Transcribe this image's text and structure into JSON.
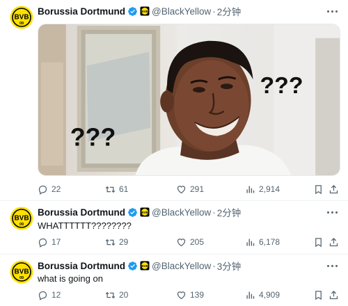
{
  "account": {
    "name": "Borussia Dortmund",
    "handle": "@BlackYellow",
    "separator": "·",
    "avatar_text": "BVB",
    "avatar_sub": "09",
    "brand_yellow": "#fde100",
    "brand_black": "#000000",
    "verified_color": "#1d9bf0"
  },
  "tweets": [
    {
      "time": "2分钟",
      "text": "",
      "media": {
        "left_marks": "???",
        "right_marks": "???"
      },
      "stats": {
        "replies": "22",
        "retweets": "61",
        "likes": "291",
        "views": "2,914"
      }
    },
    {
      "time": "2分钟",
      "text": "WHATTTTTT????????",
      "stats": {
        "replies": "17",
        "retweets": "29",
        "likes": "205",
        "views": "6,178"
      }
    },
    {
      "time": "3分钟",
      "text": "what is going on",
      "stats": {
        "replies": "12",
        "retweets": "20",
        "likes": "139",
        "views": "4,909"
      }
    }
  ],
  "icons": {
    "reply": "reply-icon",
    "retweet": "retweet-icon",
    "like": "heart-icon",
    "views": "views-icon",
    "bookmark": "bookmark-icon",
    "share": "share-icon",
    "more": "more-icon",
    "verified": "verified-badge-icon",
    "affiliate": "affiliate-badge-icon"
  }
}
